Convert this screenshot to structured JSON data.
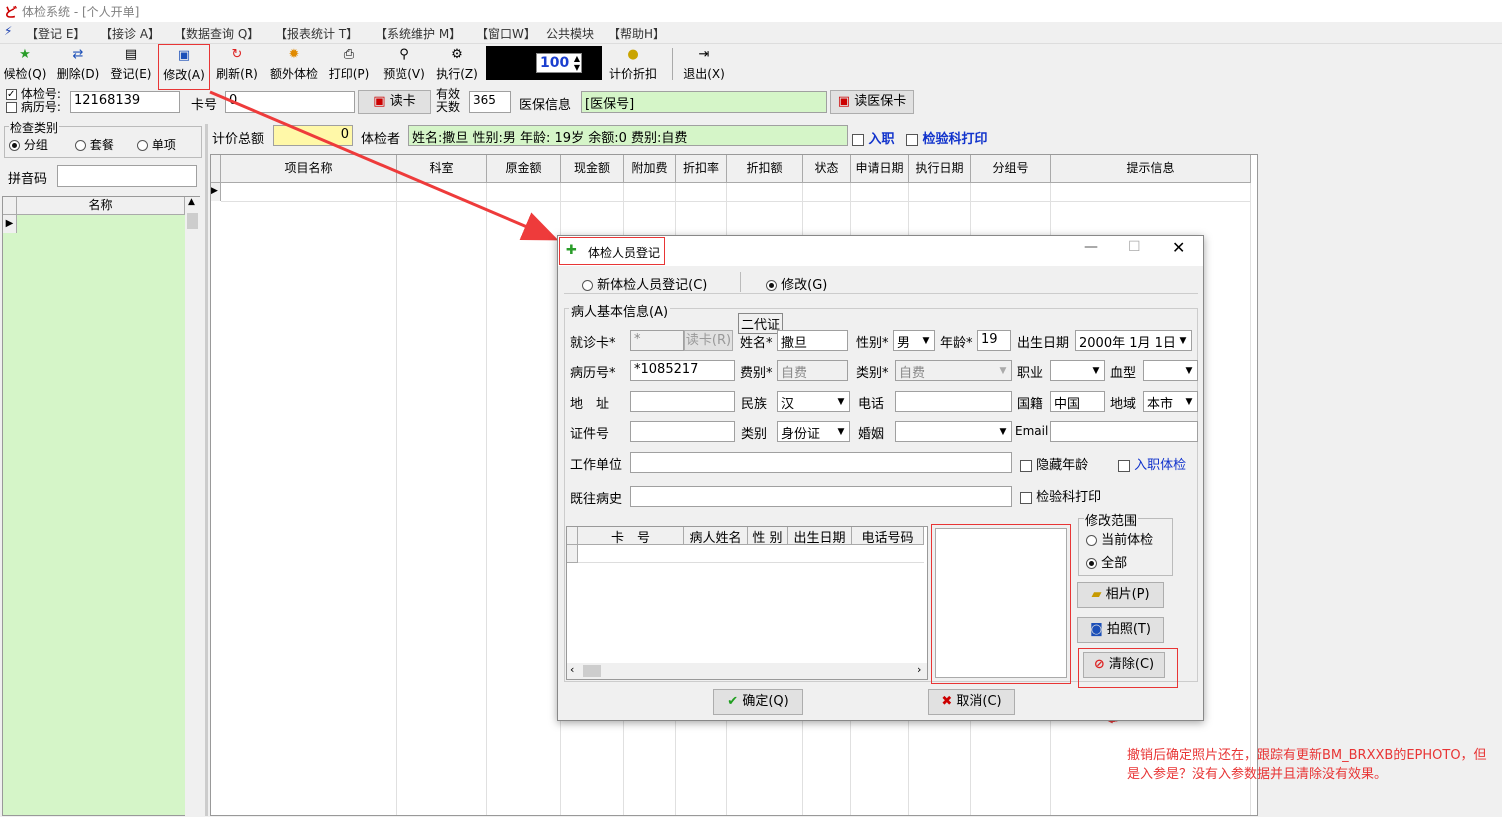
{
  "window": {
    "title": "体检系统 - [个人开单]"
  },
  "menu": [
    "【登记 E】",
    "【接诊 A】",
    "【数据查询 Q】",
    "【报表统计 T】",
    "【系统维护 M】",
    "【窗口W】",
    "公共模块",
    "【帮助H】"
  ],
  "toolbar": {
    "items": [
      "候检(Q)",
      "删除(D)",
      "登记(E)",
      "修改(A)",
      "刷新(R)",
      "额外体检",
      "打印(P)",
      "预览(V)",
      "执行(Z)",
      "计价折扣",
      "退出(X)"
    ],
    "zoom": "100"
  },
  "search": {
    "exam_no_label": "体检号:",
    "record_no_label": "病历号:",
    "exam_no_value": "12168139",
    "card_label": "卡号",
    "card_value": "0",
    "read_card": "读卡",
    "valid_days_label1": "有效",
    "valid_days_label2": "天数",
    "valid_days": "365",
    "insurance_label": "医保信息",
    "insurance_value": "[医保号]",
    "read_insurance": "读医保卡"
  },
  "sidebar": {
    "group_title": "检查类别",
    "options": [
      "分组",
      "套餐",
      "单项"
    ],
    "pinyin_label": "拼音码",
    "col_name": "名称"
  },
  "summary": {
    "total_label": "计价总额",
    "total_value": "0",
    "examinee_label": "体检者",
    "examinee_value": "姓名:撒旦 性别:男 年龄: 19岁 余额:0 费别:自费",
    "onboard": "入职",
    "lab_print": "检验科打印"
  },
  "grid_columns": [
    "项目名称",
    "科室",
    "原金额",
    "现金额",
    "附加费",
    "折扣率",
    "折扣额",
    "状态",
    "申请日期",
    "执行日期",
    "分组号",
    "提示信息"
  ],
  "dialog": {
    "title": "体检人员登记",
    "mode_new": "新体检人员登记(C)",
    "mode_edit": "修改(G)",
    "section": "病人基本信息(A)",
    "id2": "二代证",
    "card_label": "就诊卡*",
    "card_value": "*",
    "read_card": "读卡(R)",
    "name_label": "姓名*",
    "name_value": "撒旦",
    "gender_label": "性别*",
    "gender_value": "男",
    "age_label": "年龄*",
    "age_value": "19",
    "dob_label": "出生日期",
    "dob_value": "2000年 1月 1日",
    "record_label": "病历号*",
    "record_value": "*1085217",
    "fee_label": "费别*",
    "fee_value": "自费",
    "category_label": "类别*",
    "category_value": "自费",
    "job_label": "职业",
    "blood_label": "血型",
    "address_label": "地　址",
    "ethnic_label": "民族",
    "ethnic_value": "汉",
    "phone_label": "电话",
    "nation_label": "国籍",
    "nation_value": "中国",
    "region_label": "地域",
    "region_value": "本市",
    "idno_label": "证件号",
    "idtype_label": "类别",
    "idtype_value": "身份证",
    "marriage_label": "婚姻",
    "email_label": "Email",
    "work_label": "工作单位",
    "hide_age": "隐藏年龄",
    "onboard_exam": "入职体检",
    "history_label": "既往病史",
    "lab_print": "检验科打印",
    "list_cols": [
      "卡　号",
      "病人姓名",
      "性 别",
      "出生日期",
      "电话号码"
    ],
    "scope_title": "修改范围",
    "scope_current": "当前体检",
    "scope_all": "全部",
    "photo": "相片(P)",
    "take_photo": "拍照(T)",
    "clear": "清除(C)",
    "ok": "确定(Q)",
    "cancel": "取消(C)"
  },
  "annotation": "撤销后确定照片还在，跟踪有更新BM_BRXXB的EPHOTO，但是入参是？没有入参数据并且清除没有效果。"
}
